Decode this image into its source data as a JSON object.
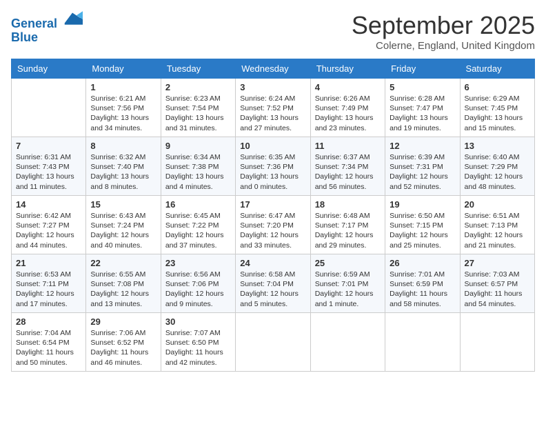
{
  "header": {
    "logo_line1": "General",
    "logo_line2": "Blue",
    "month_title": "September 2025",
    "subtitle": "Colerne, England, United Kingdom"
  },
  "days_of_week": [
    "Sunday",
    "Monday",
    "Tuesday",
    "Wednesday",
    "Thursday",
    "Friday",
    "Saturday"
  ],
  "weeks": [
    [
      {
        "num": "",
        "info": ""
      },
      {
        "num": "1",
        "info": "Sunrise: 6:21 AM\nSunset: 7:56 PM\nDaylight: 13 hours\nand 34 minutes."
      },
      {
        "num": "2",
        "info": "Sunrise: 6:23 AM\nSunset: 7:54 PM\nDaylight: 13 hours\nand 31 minutes."
      },
      {
        "num": "3",
        "info": "Sunrise: 6:24 AM\nSunset: 7:52 PM\nDaylight: 13 hours\nand 27 minutes."
      },
      {
        "num": "4",
        "info": "Sunrise: 6:26 AM\nSunset: 7:49 PM\nDaylight: 13 hours\nand 23 minutes."
      },
      {
        "num": "5",
        "info": "Sunrise: 6:28 AM\nSunset: 7:47 PM\nDaylight: 13 hours\nand 19 minutes."
      },
      {
        "num": "6",
        "info": "Sunrise: 6:29 AM\nSunset: 7:45 PM\nDaylight: 13 hours\nand 15 minutes."
      }
    ],
    [
      {
        "num": "7",
        "info": "Sunrise: 6:31 AM\nSunset: 7:43 PM\nDaylight: 13 hours\nand 11 minutes."
      },
      {
        "num": "8",
        "info": "Sunrise: 6:32 AM\nSunset: 7:40 PM\nDaylight: 13 hours\nand 8 minutes."
      },
      {
        "num": "9",
        "info": "Sunrise: 6:34 AM\nSunset: 7:38 PM\nDaylight: 13 hours\nand 4 minutes."
      },
      {
        "num": "10",
        "info": "Sunrise: 6:35 AM\nSunset: 7:36 PM\nDaylight: 13 hours\nand 0 minutes."
      },
      {
        "num": "11",
        "info": "Sunrise: 6:37 AM\nSunset: 7:34 PM\nDaylight: 12 hours\nand 56 minutes."
      },
      {
        "num": "12",
        "info": "Sunrise: 6:39 AM\nSunset: 7:31 PM\nDaylight: 12 hours\nand 52 minutes."
      },
      {
        "num": "13",
        "info": "Sunrise: 6:40 AM\nSunset: 7:29 PM\nDaylight: 12 hours\nand 48 minutes."
      }
    ],
    [
      {
        "num": "14",
        "info": "Sunrise: 6:42 AM\nSunset: 7:27 PM\nDaylight: 12 hours\nand 44 minutes."
      },
      {
        "num": "15",
        "info": "Sunrise: 6:43 AM\nSunset: 7:24 PM\nDaylight: 12 hours\nand 40 minutes."
      },
      {
        "num": "16",
        "info": "Sunrise: 6:45 AM\nSunset: 7:22 PM\nDaylight: 12 hours\nand 37 minutes."
      },
      {
        "num": "17",
        "info": "Sunrise: 6:47 AM\nSunset: 7:20 PM\nDaylight: 12 hours\nand 33 minutes."
      },
      {
        "num": "18",
        "info": "Sunrise: 6:48 AM\nSunset: 7:17 PM\nDaylight: 12 hours\nand 29 minutes."
      },
      {
        "num": "19",
        "info": "Sunrise: 6:50 AM\nSunset: 7:15 PM\nDaylight: 12 hours\nand 25 minutes."
      },
      {
        "num": "20",
        "info": "Sunrise: 6:51 AM\nSunset: 7:13 PM\nDaylight: 12 hours\nand 21 minutes."
      }
    ],
    [
      {
        "num": "21",
        "info": "Sunrise: 6:53 AM\nSunset: 7:11 PM\nDaylight: 12 hours\nand 17 minutes."
      },
      {
        "num": "22",
        "info": "Sunrise: 6:55 AM\nSunset: 7:08 PM\nDaylight: 12 hours\nand 13 minutes."
      },
      {
        "num": "23",
        "info": "Sunrise: 6:56 AM\nSunset: 7:06 PM\nDaylight: 12 hours\nand 9 minutes."
      },
      {
        "num": "24",
        "info": "Sunrise: 6:58 AM\nSunset: 7:04 PM\nDaylight: 12 hours\nand 5 minutes."
      },
      {
        "num": "25",
        "info": "Sunrise: 6:59 AM\nSunset: 7:01 PM\nDaylight: 12 hours\nand 1 minute."
      },
      {
        "num": "26",
        "info": "Sunrise: 7:01 AM\nSunset: 6:59 PM\nDaylight: 11 hours\nand 58 minutes."
      },
      {
        "num": "27",
        "info": "Sunrise: 7:03 AM\nSunset: 6:57 PM\nDaylight: 11 hours\nand 54 minutes."
      }
    ],
    [
      {
        "num": "28",
        "info": "Sunrise: 7:04 AM\nSunset: 6:54 PM\nDaylight: 11 hours\nand 50 minutes."
      },
      {
        "num": "29",
        "info": "Sunrise: 7:06 AM\nSunset: 6:52 PM\nDaylight: 11 hours\nand 46 minutes."
      },
      {
        "num": "30",
        "info": "Sunrise: 7:07 AM\nSunset: 6:50 PM\nDaylight: 11 hours\nand 42 minutes."
      },
      {
        "num": "",
        "info": ""
      },
      {
        "num": "",
        "info": ""
      },
      {
        "num": "",
        "info": ""
      },
      {
        "num": "",
        "info": ""
      }
    ]
  ]
}
